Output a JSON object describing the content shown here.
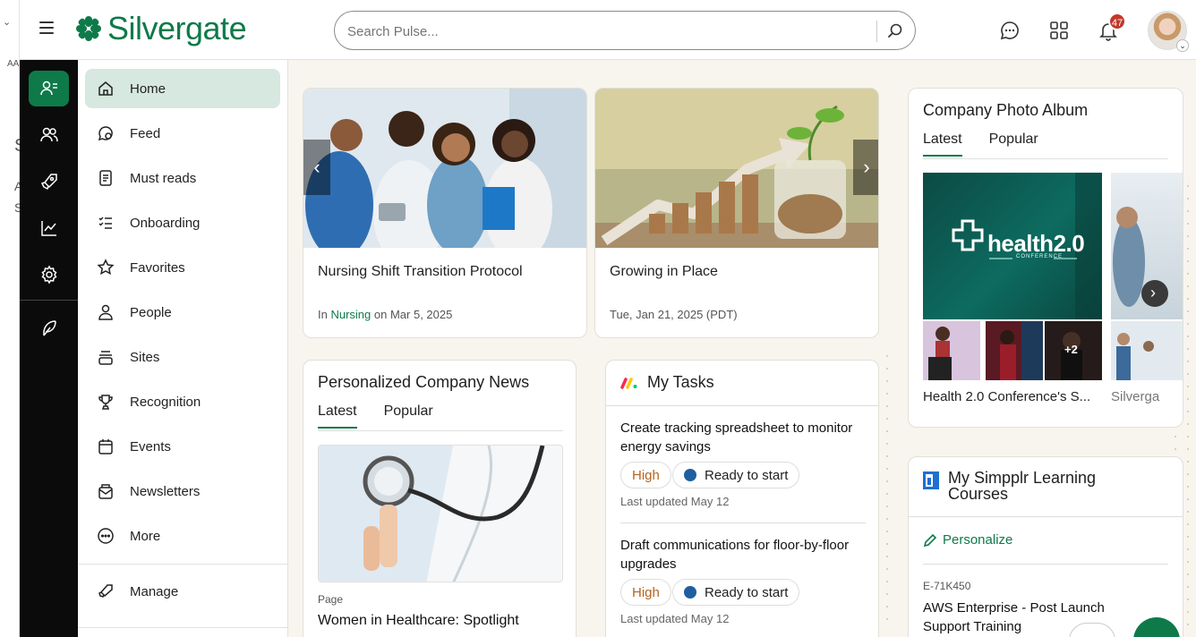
{
  "edge": {
    "label_a": "AA",
    "label_b": "S",
    "label_c": "A",
    "label_d": "S"
  },
  "header": {
    "logo_text": "Silvergate",
    "search_placeholder": "Search Pulse...",
    "notification_count": "47",
    "brand_color": "#0e7a4a"
  },
  "rail": {
    "items": [
      "person-icon",
      "people-icon",
      "rocket-icon",
      "analytics-icon",
      "gear-icon",
      "feather-icon"
    ]
  },
  "sidebar": {
    "items": [
      {
        "label": "Home",
        "icon": "home-icon",
        "active": true
      },
      {
        "label": "Feed",
        "icon": "feed-icon"
      },
      {
        "label": "Must reads",
        "icon": "must-reads-icon"
      },
      {
        "label": "Onboarding",
        "icon": "checklist-icon"
      },
      {
        "label": "Favorites",
        "icon": "star-icon"
      },
      {
        "label": "People",
        "icon": "person-icon"
      },
      {
        "label": "Sites",
        "icon": "sites-icon"
      },
      {
        "label": "Recognition",
        "icon": "trophy-icon"
      },
      {
        "label": "Events",
        "icon": "calendar-icon"
      },
      {
        "label": "Newsletters",
        "icon": "newsletter-icon"
      },
      {
        "label": "More",
        "icon": "more-icon"
      }
    ],
    "manage_label": "Manage"
  },
  "carousel": {
    "cards": [
      {
        "title": "Nursing Shift Transition Protocol",
        "meta_prefix": "In",
        "meta_link": "Nursing",
        "meta_suffix": "on Mar 5, 2025"
      },
      {
        "title": "Growing in Place",
        "meta": "Tue, Jan 21, 2025 (PDT)"
      }
    ]
  },
  "news": {
    "title": "Personalized Company News",
    "tabs": [
      "Latest",
      "Popular"
    ],
    "item_type": "Page",
    "item_title": "Women in Healthcare: Spotlight"
  },
  "tasks": {
    "title": "My Tasks",
    "items": [
      {
        "title": "Create tracking spreadsheet to monitor energy savings",
        "priority": "High",
        "status": "Ready to start",
        "updated": "Last updated May 12"
      },
      {
        "title": "Draft communications for floor-by-floor upgrades",
        "priority": "High",
        "status": "Ready to start",
        "updated": "Last updated May 12"
      }
    ]
  },
  "album": {
    "title": "Company Photo Album",
    "tabs": [
      "Latest",
      "Popular"
    ],
    "main_logo_text": "health2.0",
    "main_logo_sub": "CONFERENCE",
    "more_count": "+2",
    "captions": [
      "Health 2.0 Conference's S...",
      "Silverga"
    ]
  },
  "learning": {
    "title": "My Simpplr Learning Courses",
    "personalize_label": "Personalize",
    "course_code": "E-71K450",
    "course_title": "AWS Enterprise - Post Launch Support Training"
  }
}
